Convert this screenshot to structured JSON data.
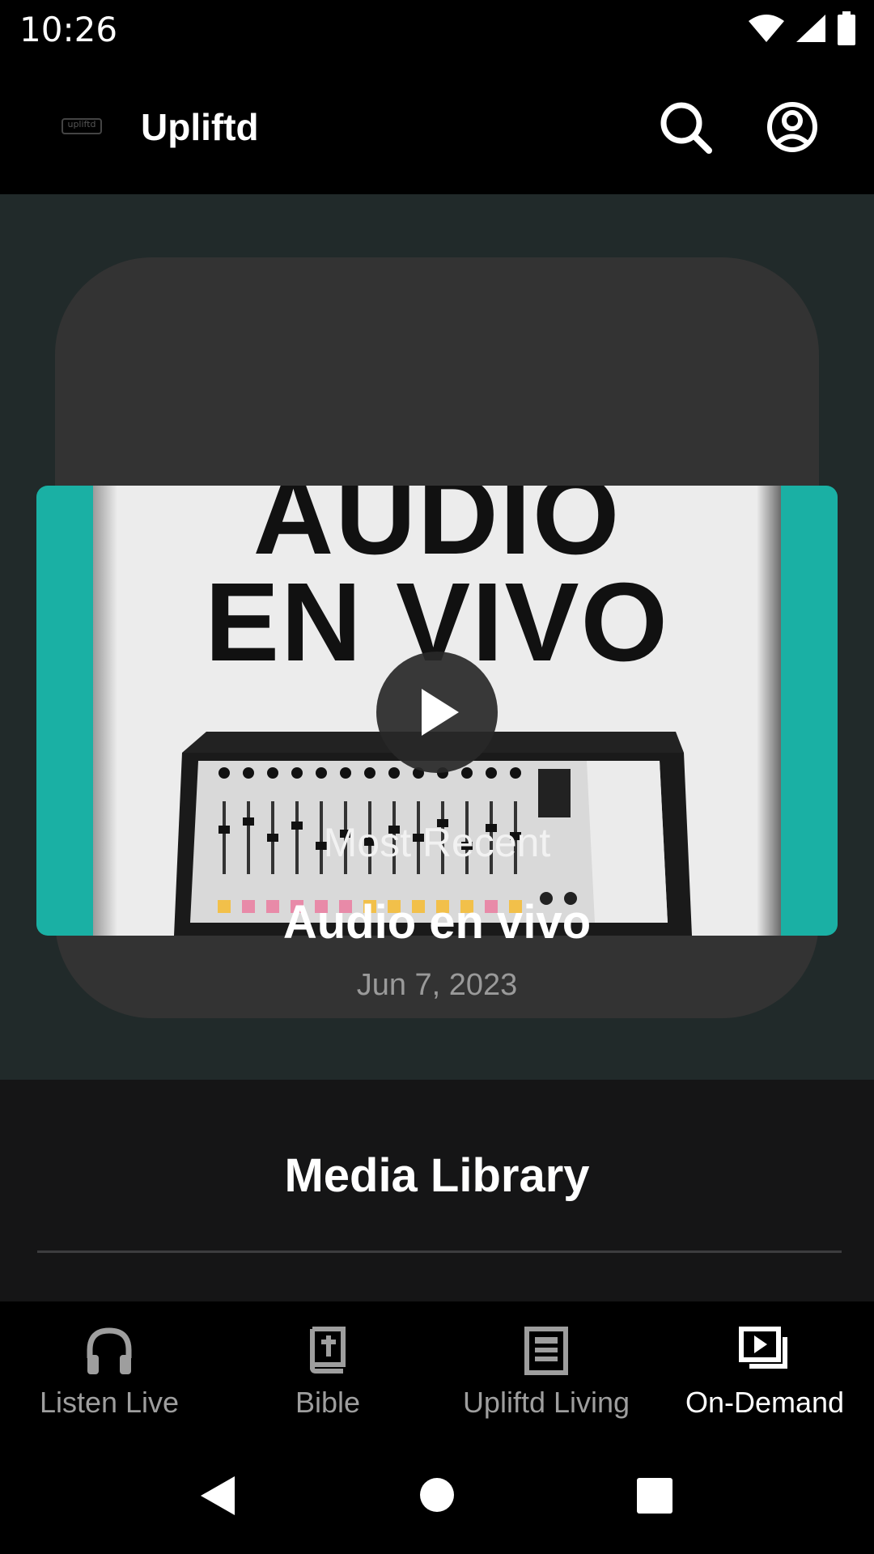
{
  "status_bar": {
    "time": "10:26",
    "icons": [
      "wifi-icon",
      "signal-icon",
      "battery-icon"
    ]
  },
  "app_bar": {
    "logo_text": "upliftd",
    "title": "Upliftd",
    "actions": [
      "search-icon",
      "account-icon"
    ]
  },
  "hero": {
    "thumbnail_text_line1": "AUDIO",
    "thumbnail_text_line2": "EN VIVO",
    "section_label": "Most Recent",
    "episode_title": "Audio en vivo",
    "episode_date": "Jun 7, 2023"
  },
  "media_library": {
    "title": "Media Library"
  },
  "bottom_nav": {
    "items": [
      {
        "label": "Listen Live",
        "icon": "headphones-icon",
        "active": false
      },
      {
        "label": "Bible",
        "icon": "bible-icon",
        "active": false
      },
      {
        "label": "Upliftd Living",
        "icon": "article-icon",
        "active": false
      },
      {
        "label": "On-Demand",
        "icon": "video-library-icon",
        "active": true
      }
    ]
  },
  "colors": {
    "hero_background": "#212a2a",
    "card_background": "#333333",
    "thumbnail_accent": "#1ab0a4",
    "nav_active": "#ffffff",
    "nav_inactive": "#9e9e9e"
  }
}
